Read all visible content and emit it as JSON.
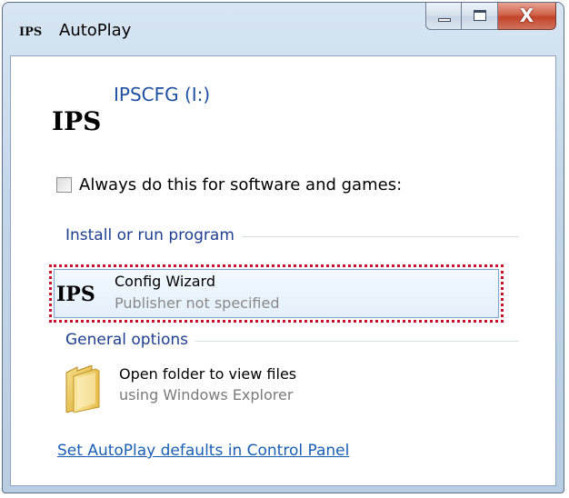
{
  "window": {
    "title": "AutoPlay",
    "title_logo": "IPS",
    "caption": {
      "minimize_icon": "minimize-icon",
      "maximize_icon": "maximize-icon",
      "close_icon": "close-icon",
      "close_glyph": "X"
    }
  },
  "device": {
    "logo": "IPS",
    "name": "IPSCFG (I:)"
  },
  "always": {
    "label": "Always do this for software and games:",
    "checked": false
  },
  "sections": {
    "install": "Install or run program",
    "general": "General options"
  },
  "install_option": {
    "logo": "IPS",
    "title": "Config Wizard",
    "subtitle": "Publisher not specified",
    "selected": true,
    "highlight_color": "#c8102e"
  },
  "folder_option": {
    "icon": "folder-icon",
    "title": "Open folder to view files",
    "subtitle": "using Windows Explorer"
  },
  "footer": {
    "link": "Set AutoPlay defaults in Control Panel"
  },
  "colors": {
    "link": "#1a5fb4",
    "section_title": "#1e3f8f",
    "device_name": "#1e50a2"
  }
}
